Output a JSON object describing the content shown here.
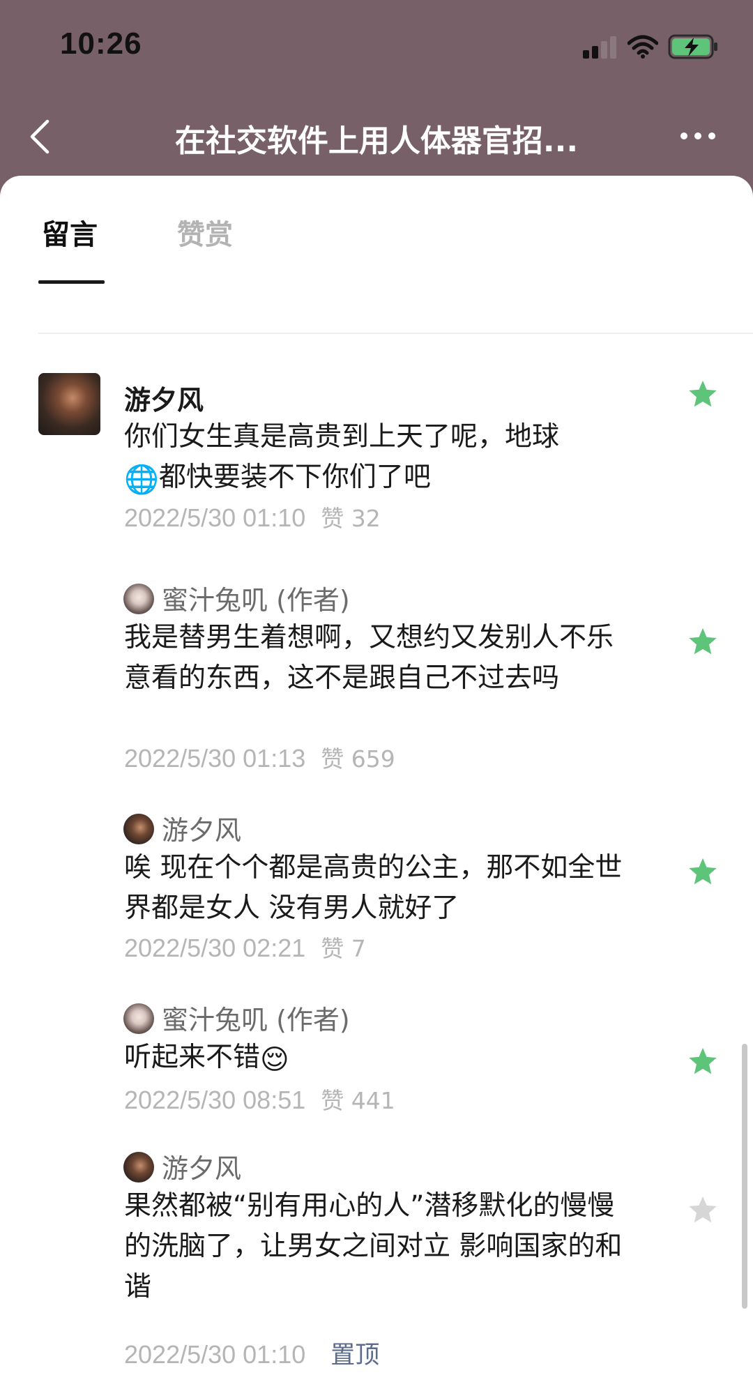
{
  "status_bar": {
    "time": "10:26"
  },
  "nav": {
    "title": "在社交软件上用人体器官招..."
  },
  "tabs": {
    "comments": "留言",
    "rewards": "赞赏"
  },
  "comments": [
    {
      "user": "游夕风",
      "text_line1": "你们女生真是高贵到上天了呢，地球",
      "text_line2_emoji": "🌐",
      "text_line2": "都快要装不下你们了吧",
      "date": "2022/5/30 01:10",
      "likes": "赞 32",
      "starred": true
    },
    {
      "user": "蜜汁兔叽 (作者)",
      "text": "我是替男生着想啊，又想约又发别人不乐意看的东西，这不是跟自己不过去吗",
      "date": "2022/5/30 01:13",
      "likes": "赞 659",
      "starred": true
    },
    {
      "user": "游夕风",
      "text": "唉 现在个个都是高贵的公主，那不如全世界都是女人 没有男人就好了",
      "date": "2022/5/30 02:21",
      "likes": "赞 7",
      "starred": true
    },
    {
      "user": "蜜汁兔叽 (作者)",
      "text": "听起来不错",
      "emoji": "😌",
      "date": "2022/5/30 08:51",
      "likes": "赞 441",
      "starred": true
    },
    {
      "user": "游夕风",
      "text": "果然都被“别有用心的人”潜移默化的慢慢的洗脑了，让男女之间对立 影响国家的和谐",
      "date": "2022/5/30 01:10",
      "action": "置顶",
      "starred": false
    }
  ],
  "colors": {
    "header_bg": "#776068",
    "star_active": "#5dc47a",
    "star_inactive": "#d6d6d6",
    "meta_text": "#b5b5b5",
    "pin_text": "#5b6b8c"
  },
  "icons": {
    "back": "chevron-left-icon",
    "more": "more-horizontal-icon",
    "star": "star-icon"
  }
}
